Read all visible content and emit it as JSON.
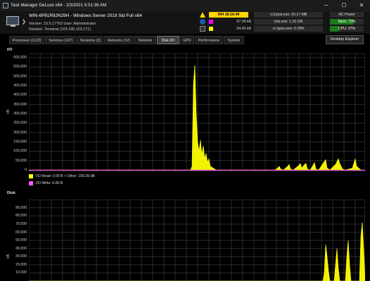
{
  "window": {
    "title": "Task Manager DeLuxe x64 - 2/3/2021 6:51:39 AM",
    "minimize": "─",
    "maximize": "☐",
    "close": "✕"
  },
  "system": {
    "hostname": "WIN-6P81R8JN29H - Windows Server 2019 Std Full x64",
    "version": "Version: 10.0.17763   User: Administrator",
    "session": "Session: Terminal (103.195.103.171)",
    "chevron": "❯"
  },
  "status": {
    "time": "004 18:16:49",
    "process_rows": [
      {
        "value": "67.09 kB",
        "color": "#ff00ff"
      },
      {
        "value": "54.45 kB",
        "color": "#ffff00"
      }
    ],
    "top_processes": [
      "cc1plus.exe: 20.17 MB",
      "bds.exe: 1.16 GB",
      "cc1plus.exe: 0.78%"
    ],
    "power": "AC Power",
    "mem": "Mem: 70%",
    "mem_percent": 70,
    "cpu": "CPU: 27%",
    "cpu_percent": 27
  },
  "tabs": [
    {
      "label": "Processes (1129)"
    },
    {
      "label": "Services (197)"
    },
    {
      "label": "Sessions (3)"
    },
    {
      "label": "Autoruns (12)"
    },
    {
      "label": "Network"
    },
    {
      "label": "Disk I/O",
      "active": true
    },
    {
      "label": "GPU"
    },
    {
      "label": "Performance"
    },
    {
      "label": "System"
    }
  ],
  "desktop_explorer": "Desktop Explorer",
  "io_chart": {
    "title": "I/O",
    "unit": "kB",
    "ticks": [
      "600,000",
      "550,000",
      "500,000",
      "450,000",
      "400,000",
      "350,000",
      "300,000",
      "250,000",
      "200,000",
      "150,000",
      "100,000",
      "50,000",
      "0"
    ],
    "legend_read": "I/O Read: 0.00 B + Other: 100.35 kB",
    "legend_write": "I/O Write: 0.00 B",
    "read_color": "#ffff00",
    "write_color": "#ff55ff"
  },
  "disk_chart": {
    "title": "Disk",
    "unit": "kB",
    "ticks": [
      "90,000",
      "80,000",
      "70,000",
      "60,000",
      "50,000",
      "40,000",
      "30,000",
      "20,000",
      "10,000"
    ]
  },
  "chart_data": [
    {
      "type": "area",
      "title": "I/O",
      "ylabel": "kB",
      "ylim": [
        0,
        600000
      ],
      "grid": true,
      "series": [
        {
          "name": "I/O Read: 0.00 B + Other: 100.35 kB",
          "color": "#ffff00",
          "points": [
            [
              0,
              0
            ],
            [
              230,
              0
            ],
            [
              232,
              20000
            ],
            [
              234,
              460000
            ],
            [
              236,
              560000
            ],
            [
              238,
              300000
            ],
            [
              240,
              150000
            ],
            [
              242,
              100000
            ],
            [
              244,
              160000
            ],
            [
              246,
              80000
            ],
            [
              248,
              130000
            ],
            [
              250,
              60000
            ],
            [
              252,
              90000
            ],
            [
              254,
              40000
            ],
            [
              256,
              60000
            ],
            [
              258,
              20000
            ],
            [
              262,
              10000
            ],
            [
              266,
              0
            ],
            [
              350,
              0
            ],
            [
              352,
              5000
            ],
            [
              356,
              20000
            ],
            [
              358,
              5000
            ],
            [
              362,
              0
            ],
            [
              368,
              20000
            ],
            [
              370,
              30000
            ],
            [
              372,
              5000
            ],
            [
              376,
              0
            ],
            [
              384,
              25000
            ],
            [
              386,
              35000
            ],
            [
              388,
              10000
            ],
            [
              392,
              30000
            ],
            [
              394,
              35000
            ],
            [
              396,
              5000
            ],
            [
              400,
              0
            ],
            [
              404,
              25000
            ],
            [
              406,
              40000
            ],
            [
              408,
              5000
            ],
            [
              412,
              0
            ],
            [
              420,
              45000
            ],
            [
              422,
              55000
            ],
            [
              424,
              10000
            ],
            [
              428,
              0
            ],
            [
              436,
              30000
            ],
            [
              440,
              60000
            ],
            [
              442,
              35000
            ],
            [
              446,
              5000
            ],
            [
              450,
              0
            ],
            [
              460,
              10000
            ],
            [
              464,
              60000
            ],
            [
              466,
              20000
            ],
            [
              472,
              0
            ],
            [
              478,
              0
            ]
          ]
        },
        {
          "name": "I/O Write: 0.00 B",
          "color": "#ff55ff",
          "points": [
            [
              0,
              0
            ],
            [
              478,
              0
            ]
          ]
        }
      ]
    },
    {
      "type": "area",
      "title": "Disk",
      "ylabel": "kB",
      "ylim": [
        0,
        95000
      ],
      "grid": true,
      "series": [
        {
          "name": "I/O Read",
          "color": "#ffff00",
          "points": [
            [
              0,
              0
            ],
            [
              418,
              0
            ],
            [
              420,
              10000
            ],
            [
              422,
              45000
            ],
            [
              424,
              30000
            ],
            [
              426,
              12000
            ],
            [
              428,
              0
            ],
            [
              434,
              0
            ],
            [
              436,
              20000
            ],
            [
              438,
              40000
            ],
            [
              440,
              15000
            ],
            [
              442,
              0
            ],
            [
              450,
              0
            ],
            [
              452,
              30000
            ],
            [
              454,
              50000
            ],
            [
              456,
              20000
            ],
            [
              458,
              0
            ],
            [
              470,
              0
            ],
            [
              472,
              55000
            ],
            [
              474,
              72000
            ],
            [
              476,
              40000
            ],
            [
              478,
              0
            ]
          ]
        }
      ]
    }
  ]
}
